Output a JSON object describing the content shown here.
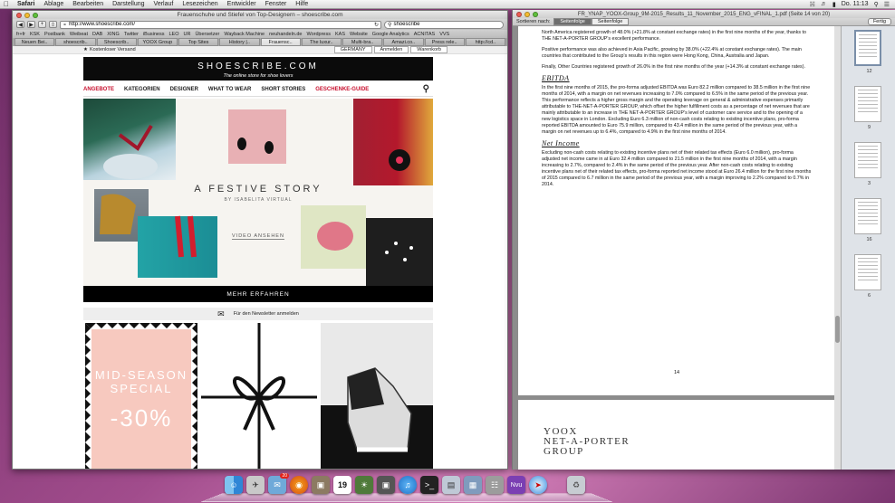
{
  "menubar": {
    "app": "Safari",
    "items": [
      "Ablage",
      "Bearbeiten",
      "Darstellung",
      "Verlauf",
      "Lesezeichen",
      "Entwickler",
      "Fenster",
      "Hilfe"
    ],
    "clock": "Do. 11:13"
  },
  "safari": {
    "title": "Frauenschuhe und Stiefel von Top-Designern – shoescribe.com",
    "url": "http://www.shoescribe.com/",
    "search": "shoescribe",
    "bookmarks": [
      "fr+fr",
      "KSK",
      "Postbank",
      "Weibeat",
      "DAB",
      "XING",
      "Twitter",
      "iBusiness",
      "LEO",
      "UR",
      "Übersetzer",
      "Wayback Machine",
      "neuhandeln.de",
      "Wordpress",
      "KAS",
      "Website",
      "Google Analytics",
      "ACNITAS",
      "VVS"
    ],
    "tabs": [
      "Neuen Bei..",
      "shoescrib..",
      "Shoescrib..",
      "YOOX Group",
      "Top Sites",
      "History |..",
      "Frauensc..",
      "The luxur..",
      "Multi-bra..",
      "Amazi.co..",
      "Press rele..",
      "http://cd.."
    ],
    "active_tab": 6
  },
  "site": {
    "shipping": "Kostenloser Versand",
    "country": "GERMANY",
    "login": "Anmelden",
    "cart": "Warenkorb",
    "logo": "SHOESCRIBE.COM",
    "tagline": "The online store for shoe lovers",
    "nav": [
      "ANGEBOTE",
      "KATEGORIEN",
      "DESIGNER",
      "WHAT TO WEAR",
      "SHORT STORIES",
      "GESCHENKE-GUIDE"
    ],
    "hero_title": "A FESTIVE STORY",
    "hero_sub": "BY ISABELITA VIRTUAL",
    "video": "VIDEO ANSEHEN",
    "more": "MEHR ERFAHREN",
    "newsletter": "Für den Newsletter anmelden",
    "promo_title": "MID-SEASON SPECIAL",
    "promo_pct": "-30%",
    "colors": {
      "accent_red": "#c8102e",
      "promo_pink": "#f7c9bf"
    }
  },
  "preview": {
    "title": "FR_YNAP_YOOX-Group_9M-2015_Results_11_November_2015_ENG_vFINAL_1.pdf (Seite 14 von 20)",
    "sort_label": "Sortieren nach:",
    "segments": [
      "Seitenfolge",
      "Seitenfolge"
    ],
    "done": "Fertig",
    "page_number": "14",
    "brand": [
      "YOOX",
      "NET-A-PORTER",
      "GROUP"
    ],
    "paragraphs": [
      "North America registered growth of 48.0% (+21.8% at constant exchange rates) in the first nine months of the year, thanks to THE NET-A-PORTER GROUP’s excellent performance.",
      "Positive performance was also achieved in Asia Pacific, growing by 38.0% (+22.4% at constant exchange rates). The main countries that contributed to the Group’s results in this region were Hong Kong, China, Australia and Japan.",
      "Finally, Other Countries registered growth of 26.0% in the first nine months of the year (+14.3% at constant exchange rates)."
    ],
    "h_ebitda": "EBITDA",
    "ebitda_text": "In the first nine months of 2015, the pro-forma adjusted EBITDA was Euro 82.2 million compared to 38.5 million in the first nine months of 2014, with a margin on net revenues increasing to 7.0% compared to 6.5% in the same period of the previous year. This performance reflects a higher gross margin and the operating leverage on general & administrative expenses primarily attributable to THE-NET-A-PORTER GROUP, which offset the higher fulfillment costs as a percentage of net revenues that are mainly attributable to an increase in THE NET-A-PORTER GROUP’s level of customer care service and to the opening of a new logistics space in London. Excluding Euro 6.3 million of non-cash costs relating to existing incentive plans, pro-forma reported EBITDA amounted to Euro 75.9 million, compared to 43.4 million in the same period of the previous year, with a margin on net revenues up to 6.4%, compared to 4.9% in the first nine months of 2014.",
    "h_netincome": "Net Income",
    "net_text": "Excluding non-cash costs relating to existing incentive plans net of their related tax effects (Euro 6.0 million), pro-forma adjusted net income came in at Euro 32.4 million compared to 21.5 million in the first nine months of 2014, with a margin increasing to 2.7%, compared to 2.4% in the same period of the previous year. After non-cash costs relating to existing incentive plans net of their related tax effects, pro-forma reported net income stood at Euro 26.4 million for the first nine months of 2015 compared to 6.7 million in the same period of the previous year, with a margin improving to 2.2% compared to 0.7% in 2014.",
    "thumb_labels": [
      "12",
      "9",
      "3",
      "16",
      "6"
    ]
  },
  "dock": {
    "badge": "20",
    "calendar_day": "19"
  }
}
